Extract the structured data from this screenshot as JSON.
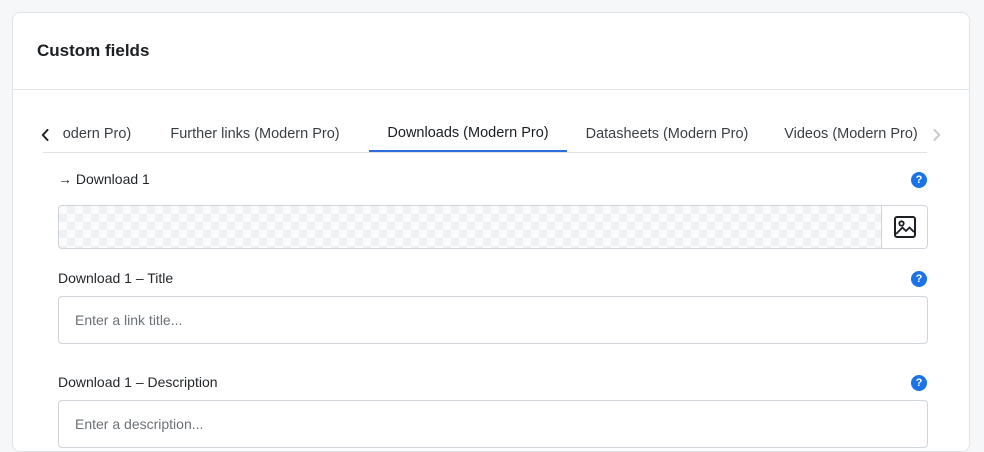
{
  "card": {
    "title": "Custom fields"
  },
  "tabs": {
    "items": [
      {
        "label": "odern Pro)",
        "active": false
      },
      {
        "label": "Further links (Modern Pro)",
        "active": false
      },
      {
        "label": "Downloads (Modern Pro)",
        "active": true
      },
      {
        "label": "Datasheets (Modern Pro)",
        "active": false
      },
      {
        "label": "Videos (Modern Pro)",
        "active": false
      }
    ],
    "prev_icon": "chevron-left-icon",
    "next_icon": "chevron-right-icon"
  },
  "fields": {
    "download1": {
      "label": "→ Download 1",
      "help": "?",
      "button_icon": "image-icon"
    },
    "title": {
      "label": "Download 1 – Title",
      "help": "?",
      "placeholder": "Enter a link title...",
      "value": ""
    },
    "description": {
      "label": "Download 1 – Description",
      "help": "?",
      "placeholder": "Enter a description...",
      "value": ""
    }
  },
  "colors": {
    "accent": "#2d6cdf",
    "help_badge": "#1a73e8"
  }
}
